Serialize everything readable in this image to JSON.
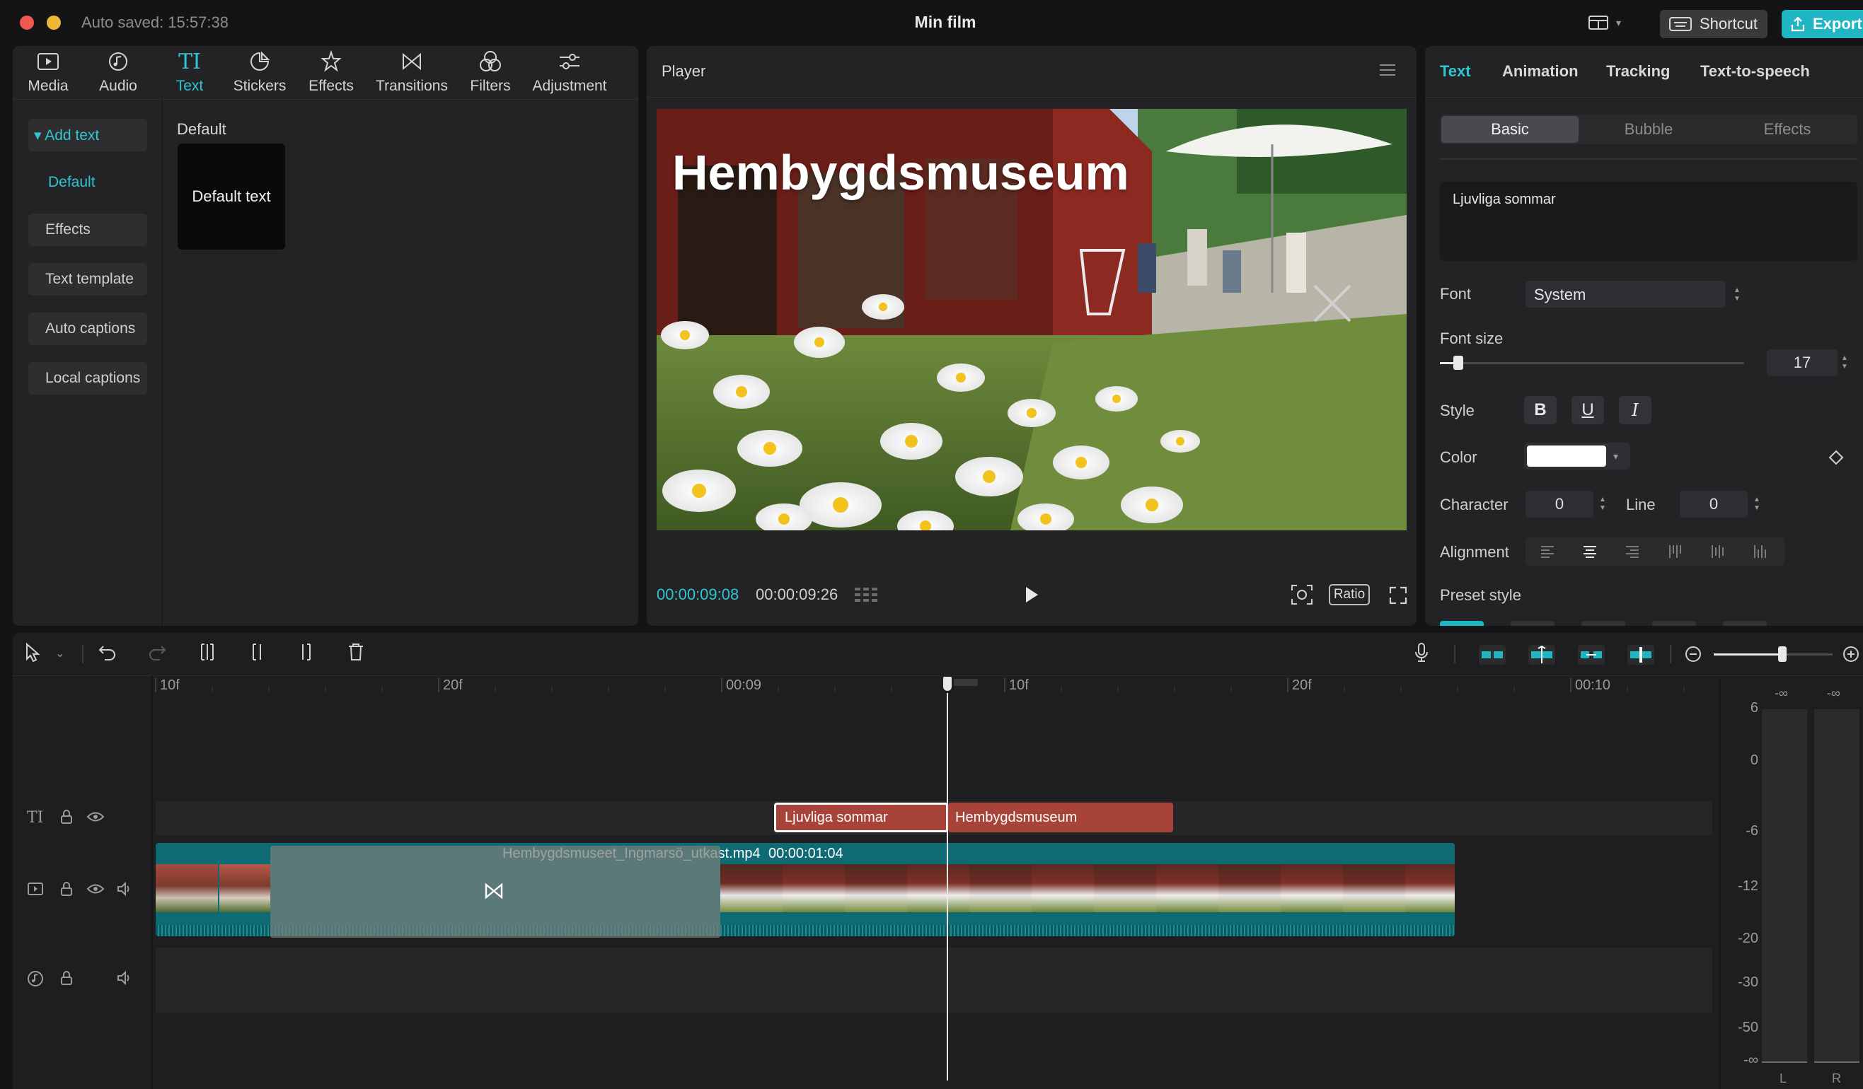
{
  "window": {
    "autosave": "Auto saved: 15:57:38",
    "title": "Min film",
    "shortcut_label": "Shortcut",
    "export_label": "Export"
  },
  "toolbar": {
    "tabs": [
      {
        "label": "Media",
        "icon": "media-icon"
      },
      {
        "label": "Audio",
        "icon": "audio-icon"
      },
      {
        "label": "Text",
        "icon": "text-icon",
        "active": true
      },
      {
        "label": "Stickers",
        "icon": "stickers-icon"
      },
      {
        "label": "Effects",
        "icon": "effects-icon"
      },
      {
        "label": "Transitions",
        "icon": "transitions-icon"
      },
      {
        "label": "Filters",
        "icon": "filters-icon"
      },
      {
        "label": "Adjustment",
        "icon": "adjustment-icon"
      }
    ]
  },
  "sidebar": {
    "items": [
      {
        "label": "▾ Add text",
        "active": true
      },
      {
        "label": "Default",
        "selected": true
      },
      {
        "label": "Effects"
      },
      {
        "label": "Text template"
      },
      {
        "label": "Auto captions"
      },
      {
        "label": "Local captions"
      }
    ]
  },
  "library": {
    "section_title": "Default",
    "card_label": "Default text"
  },
  "player": {
    "title": "Player",
    "overlay_text": "Hembygdsmuseum",
    "current_time": "00:00:09:08",
    "total_time": "00:00:09:26",
    "ratio_label": "Ratio"
  },
  "properties": {
    "tabs": [
      "Text",
      "Animation",
      "Tracking",
      "Text-to-speech"
    ],
    "subtabs": [
      "Basic",
      "Bubble",
      "Effects"
    ],
    "text_value": "Ljuvliga sommar",
    "font_label": "Font",
    "font_value": "System",
    "font_size_label": "Font size",
    "font_size_value": "17",
    "font_size_fraction": 0.06,
    "style_label": "Style",
    "style_buttons": [
      "B",
      "U",
      "I"
    ],
    "color_label": "Color",
    "color_value": "#ffffff",
    "character_label": "Character",
    "character_value": "0",
    "line_label": "Line",
    "line_value": "0",
    "alignment_label": "Alignment",
    "preset_label": "Preset style"
  },
  "timeline": {
    "ruler": [
      "10f",
      "20f",
      "00:09",
      "10f",
      "20f",
      "00:10"
    ],
    "text_clips": [
      "Ljuvliga sommar",
      "Hembygdsmuseum"
    ],
    "video_clip_name": "Hembygdsmuseet_Ingmarsö_utkast.mp4",
    "video_clip_duration": "00:00:01:04",
    "zoom_fraction": 0.58
  },
  "meter": {
    "labels": [
      "-∞",
      "-∞",
      "6",
      "0",
      "-6",
      "-12",
      "-20",
      "-30",
      "-50",
      "-∞"
    ],
    "channels": [
      "L",
      "R"
    ]
  },
  "colors": {
    "accent": "#2fc5d3",
    "text_clip": "#a8433a",
    "video_clip": "#0f6b73",
    "panel": "#232326",
    "background": "#141416"
  }
}
